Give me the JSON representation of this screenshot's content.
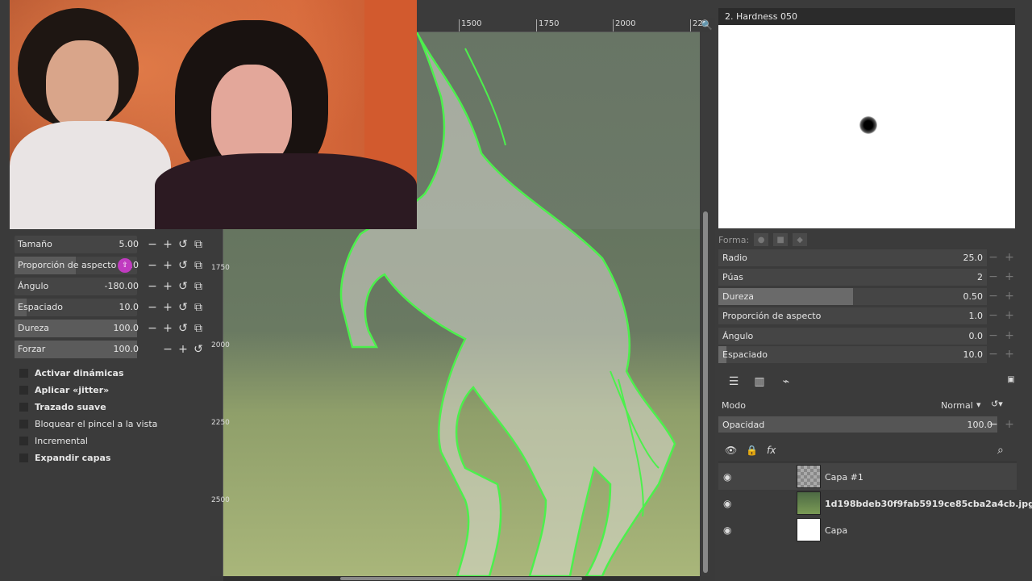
{
  "tool_options": {
    "rows": [
      {
        "label": "Tamaño",
        "value": "5.00",
        "fill": 0.0
      },
      {
        "label": "Proporción de aspecto",
        "value": "0.0",
        "fill": 0.5
      },
      {
        "label": "Ángulo",
        "value": "-180.00",
        "fill": 0.0
      },
      {
        "label": "Espaciado",
        "value": "10.0",
        "fill": 0.1
      },
      {
        "label": "Dureza",
        "value": "100.0",
        "fill": 1.0
      },
      {
        "label": "Forzar",
        "value": "100.0",
        "fill": 1.0
      }
    ],
    "checks": [
      {
        "label": "Activar dinámicas",
        "bold": true
      },
      {
        "label": "Aplicar «jitter»",
        "bold": true
      },
      {
        "label": "Trazado suave",
        "bold": true
      },
      {
        "label": "Bloquear el pincel a la vista",
        "bold": false
      },
      {
        "label": "Incremental",
        "bold": false
      },
      {
        "label": "Expandir capas",
        "bold": true
      }
    ]
  },
  "ruler": {
    "top_ticks": [
      "1500",
      "1750",
      "2000",
      "22"
    ],
    "left_labels": [
      "1750",
      "2000",
      "2250",
      "2500"
    ]
  },
  "brush": {
    "title": "2. Hardness 050",
    "forma_label": "Forma:",
    "rows": [
      {
        "label": "Radio",
        "value": "25.0",
        "fill": 0.0
      },
      {
        "label": "Púas",
        "value": "2",
        "fill": 0.0
      },
      {
        "label": "Dureza",
        "value": "0.50",
        "fill": 0.5
      },
      {
        "label": "Proporción de aspecto",
        "value": "1.0",
        "fill": 0.0
      },
      {
        "label": "Ángulo",
        "value": "0.0",
        "fill": 0.0
      },
      {
        "label": "Espaciado",
        "value": "10.0",
        "fill": 0.03
      }
    ]
  },
  "layers": {
    "mode_label": "Modo",
    "mode_value": "Normal",
    "opacity_label": "Opacidad",
    "opacity_value": "100.0",
    "items": [
      {
        "name": "Capa #1",
        "thumb": "check",
        "bold": false
      },
      {
        "name": "1d198bdeb30f9fab5919ce85cba2a4cb.jpg",
        "thumb": "horse",
        "bold": true
      },
      {
        "name": "Capa",
        "thumb": "white",
        "bold": false
      }
    ]
  }
}
